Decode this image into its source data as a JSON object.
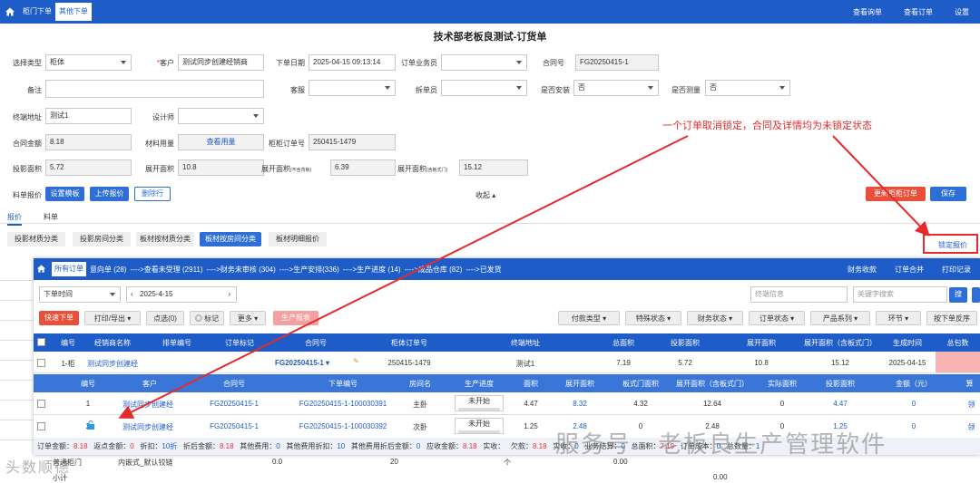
{
  "topbar": {
    "tabs": [
      "柜门下单",
      "其他下单"
    ],
    "right": [
      "查看询单",
      "查看订单",
      "设置"
    ]
  },
  "title": "技术部老板良测试-订货单",
  "form": {
    "select_type_label": "选择类型",
    "select_type_value": "柜体",
    "customer_label": "客户",
    "customer_value": "测试同步创建经销商",
    "order_date_label": "下单日期",
    "order_date_value": "2025-04-15 09:13:14",
    "salesman_label": "订单业务员",
    "salesman_value": "",
    "contract_no_label": "合同号",
    "contract_no_value": "FG20250415-1",
    "remark_label": "备注",
    "service_label": "客服",
    "split_label": "拆单员",
    "install_label": "是否安装",
    "install_value": "否",
    "measure_label": "是否测量",
    "measure_value": "否",
    "terminal_label": "终端地址",
    "terminal_value": "测试1",
    "designer_label": "设计师",
    "amount_label": "合同金额",
    "amount_value": "8.18",
    "material_label": "材料用量",
    "material_value": "查看用量",
    "cabinet_no_label": "柜柜订单号",
    "cabinet_no_value": "250415-1479",
    "proj_area_label": "投影面积",
    "proj_area_value": "5.72",
    "expand_area_label": "展开面积",
    "expand_area_value": "10.8",
    "expand_area2_label": "展开面积",
    "expand_area2_sub": "(不含背板)",
    "expand_area2_value": "6.39",
    "expand_area3_label": "展开面积",
    "expand_area3_sub": "(含板式门)",
    "expand_area3_value": "15.12",
    "quote_label": "料单报价",
    "btn_template": "设置模板",
    "btn_upload": "上传报价",
    "btn_delete": "删除行",
    "collapse": "收起 ▴",
    "btn_refresh": "更新柜柜订单",
    "btn_save": "保存"
  },
  "tabs2": [
    "报价",
    "料单"
  ],
  "cat_buttons": [
    "投影材质分类",
    "投影房间分类",
    "板材按材质分类",
    "板材按房间分类",
    "板材明细报价"
  ],
  "lock_button": "锁定报价",
  "annotation": "一个订单取消锁定，合同及详情均为未锁定状态",
  "overlay": {
    "flow": [
      "所有订单",
      "意向单 (28)",
      "---->查看未受理 (2911)",
      "---->财务未审核 (304)",
      "---->生产安排(336)",
      "---->生产进度 (14)",
      "---->成品仓库 (82)",
      "---->已发货"
    ],
    "right": [
      "财务收款",
      "订单合并",
      "打印记录"
    ],
    "date_filter": "下单时间",
    "date_value": "2025-4-15",
    "terminal_ph": "终端信息",
    "keyword_ph": "关键字搜索",
    "search": "搜",
    "btn_quick": "快速下单",
    "btn_print": "打印/导出 ▾",
    "btn_select": "点选(0)",
    "btn_mark": "标记",
    "btn_more": "更多 ▾",
    "btn_prod": "生产报表",
    "filters": [
      "付款类型",
      "特殊状态",
      "财务状态",
      "订单状态",
      "产品系列",
      "环节",
      "按下单反序"
    ],
    "head1": [
      "编号",
      "经销商名称",
      "排单编号",
      "订单标记",
      "合同号",
      "柜体订单号",
      "终端地址",
      "总面积",
      "投影面积",
      "展开面积",
      "展开面积（含板式门）",
      "生成时间",
      "总包数"
    ],
    "row1": {
      "no": "1-柜",
      "dealer": "测试同步创建经",
      "contract": "FG20250415-1",
      "cabinet_no": "250415-1479",
      "terminal": "测试1",
      "total": "7.19",
      "proj": "5.72",
      "expand": "10.8",
      "expand2": "15.12",
      "time": "2025-04-15"
    },
    "head2": [
      "编号",
      "客户",
      "合同号",
      "下单编号",
      "房间名",
      "生产进度",
      "面积",
      "展开面积",
      "板式门面积",
      "展开面积（含板式门）",
      "实际面积",
      "投影面积",
      "金额（元）",
      "算"
    ],
    "rows2": [
      {
        "no": "1",
        "customer": "测试同步创建经",
        "contract": "FG20250415-1",
        "order": "FG20250415-1-100030391",
        "room": "主卧",
        "progress": "未开始",
        "area": "4.47",
        "expand": "8.32",
        "door": "4.32",
        "expand2": "12.64",
        "actual": "0",
        "proj": "4.47",
        "amount": "0",
        "calc": "领"
      },
      {
        "no": "2",
        "customer": "测试同步创建经",
        "contract": "FG20250415-1",
        "order": "FG20250415-1-100030392",
        "room": "次卧",
        "progress": "未开始",
        "area": "1.25",
        "expand": "2.48",
        "door": "0",
        "expand2": "2.48",
        "actual": "0",
        "proj": "1.25",
        "amount": "0",
        "calc": "领"
      }
    ],
    "summary": [
      {
        "k": "订单金额：",
        "v": "8.18"
      },
      {
        "k": "返点金额：",
        "v": "0"
      },
      {
        "k": "折扣：",
        "v": "10折"
      },
      {
        "k": "折后金额：",
        "v": "8.18"
      },
      {
        "k": "其他费用：",
        "v": "0"
      },
      {
        "k": "其他费用折扣：",
        "v": "10"
      },
      {
        "k": "其他费用折后金额：",
        "v": "0"
      },
      {
        "k": "应收金额：",
        "v": "8.18"
      },
      {
        "k": "实收：",
        "v": ""
      },
      {
        "k": "欠款：",
        "v": "8.18"
      },
      {
        "k": "实收：",
        "v": "0"
      },
      {
        "k": "业务结算：",
        "v": "0"
      },
      {
        "k": "总面积：",
        "v": "7.19"
      },
      {
        "k": "订单成本：",
        "v": "0"
      },
      {
        "k": "总数量：",
        "v": "1"
      }
    ]
  },
  "behind_rows": {
    "r1": "普通柜门",
    "r2": "内嵌式_默认铰链",
    "r2v": "0.0",
    "r2v2": "20",
    "r2u": "个",
    "r2v3": "0.00",
    "r3": "小计",
    "r3v": "0.00"
  },
  "watermark": "服务号 · 老板良生产管理软件",
  "watermark2": "头数顺德"
}
